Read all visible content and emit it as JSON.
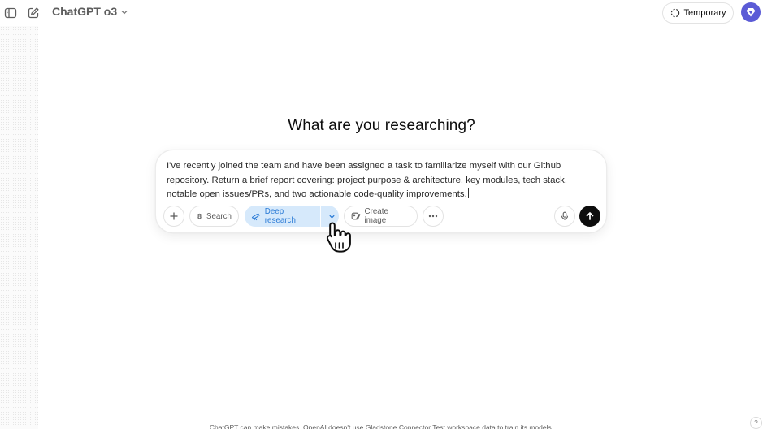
{
  "header": {
    "model_label": "ChatGPT o3",
    "temporary_label": "Temporary"
  },
  "main": {
    "heading": "What are you researching?"
  },
  "composer": {
    "text": "I've recently joined the team and have been assigned a task to familiarize myself with our Github repository. Return a brief report covering: project purpose & architecture, key modules, tech stack, notable open issues/PRs, and two actionable code-quality improvements.",
    "tools": {
      "search_label": "Search",
      "deep_research_label": "Deep research",
      "create_image_label": "Create image"
    }
  },
  "footer": {
    "disclaimer": "ChatGPT can make mistakes. OpenAI doesn't use Gladstone Connector Test workspace data to train its models.",
    "help_label": "?"
  },
  "colors": {
    "deep_research_bg": "#d6e9fb",
    "deep_research_fg": "#2b7bd6",
    "avatar": "#5b5bd6",
    "send_button": "#0d0d0d"
  },
  "icons": {
    "sidebar_toggle": "sidebar-icon",
    "new_chat": "edit-icon",
    "model_chevron": "chevron-down-icon",
    "temporary": "dashed-circle-icon",
    "plus": "plus-icon",
    "search": "globe-icon",
    "deep_research": "telescope-icon",
    "create_image": "image-brush-icon",
    "more": "ellipsis-icon",
    "mic": "microphone-icon",
    "send": "arrow-up-icon",
    "cursor": "hand-pointer-icon"
  }
}
